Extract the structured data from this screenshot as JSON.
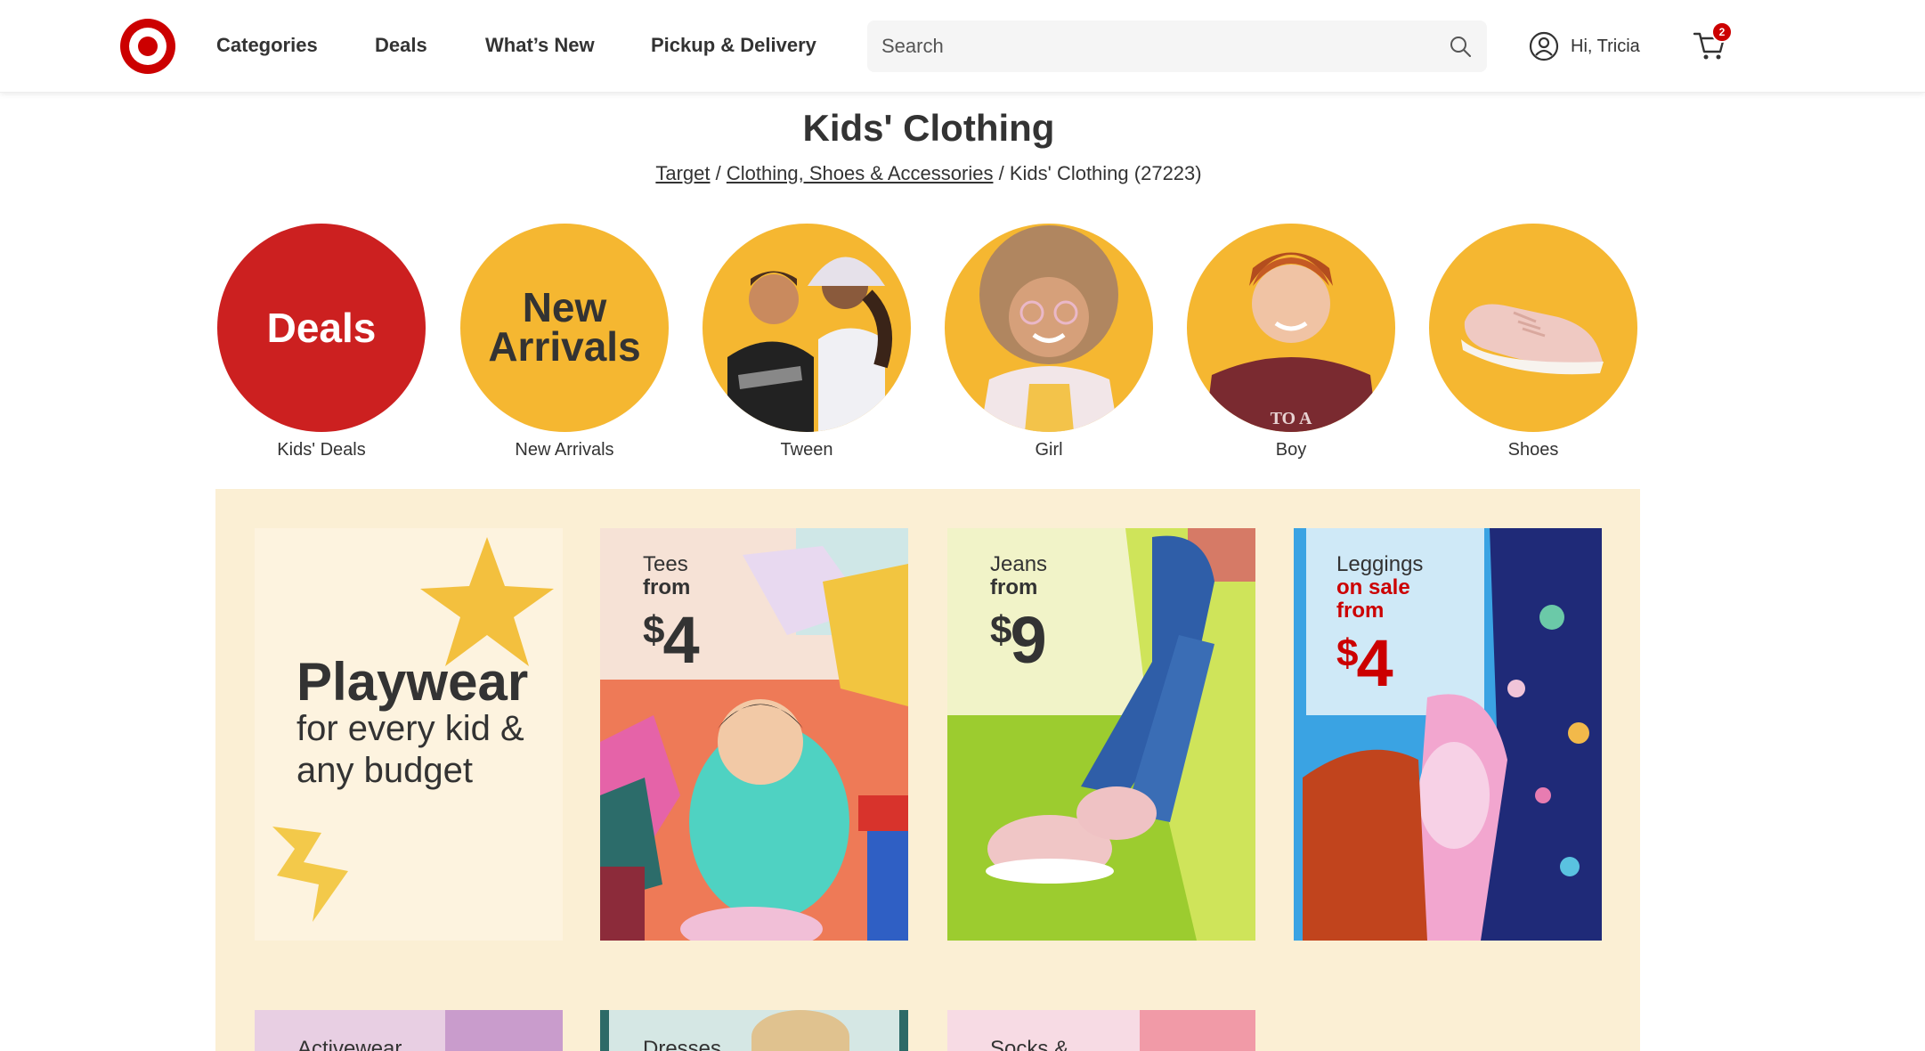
{
  "header": {
    "nav": [
      "Categories",
      "Deals",
      "What’s New",
      "Pickup & Delivery"
    ],
    "search_placeholder": "Search",
    "account_label": "Hi, Tricia",
    "cart_count": "2",
    "brand_color": "#cc0000"
  },
  "page": {
    "title": "Kids' Clothing",
    "breadcrumb": {
      "link1": "Target",
      "sep1": " / ",
      "link2": "Clothing, Shoes & Accessories",
      "sep2": " / ",
      "current": "Kids' Clothing (27223)"
    }
  },
  "categories": [
    {
      "label": "Kids' Deals",
      "circle_text": "Deals",
      "color": "#cc2020"
    },
    {
      "label": "New Arrivals",
      "circle_text_1": "New",
      "circle_text_2": "Arrivals",
      "color": "#f5b731"
    },
    {
      "label": "Tween",
      "color": "#f5b731"
    },
    {
      "label": "Girl",
      "color": "#f5b731"
    },
    {
      "label": "Boy",
      "color": "#f5b731"
    },
    {
      "label": "Shoes",
      "color": "#f5b731"
    }
  ],
  "promo": {
    "headline": "Playwear",
    "sub_1": "for every kid &",
    "sub_2": "any budget",
    "tiles": [
      {
        "name": "Tees",
        "from": "from",
        "dollar": "$",
        "price": "4"
      },
      {
        "name": "Jeans",
        "from": "from",
        "dollar": "$",
        "price": "9"
      },
      {
        "name": "Leggings",
        "on_sale": "on sale",
        "from": "from",
        "dollar": "$",
        "price": "4"
      }
    ],
    "tiles_row2": [
      "Activewear",
      "Dresses",
      "Socks &"
    ]
  }
}
